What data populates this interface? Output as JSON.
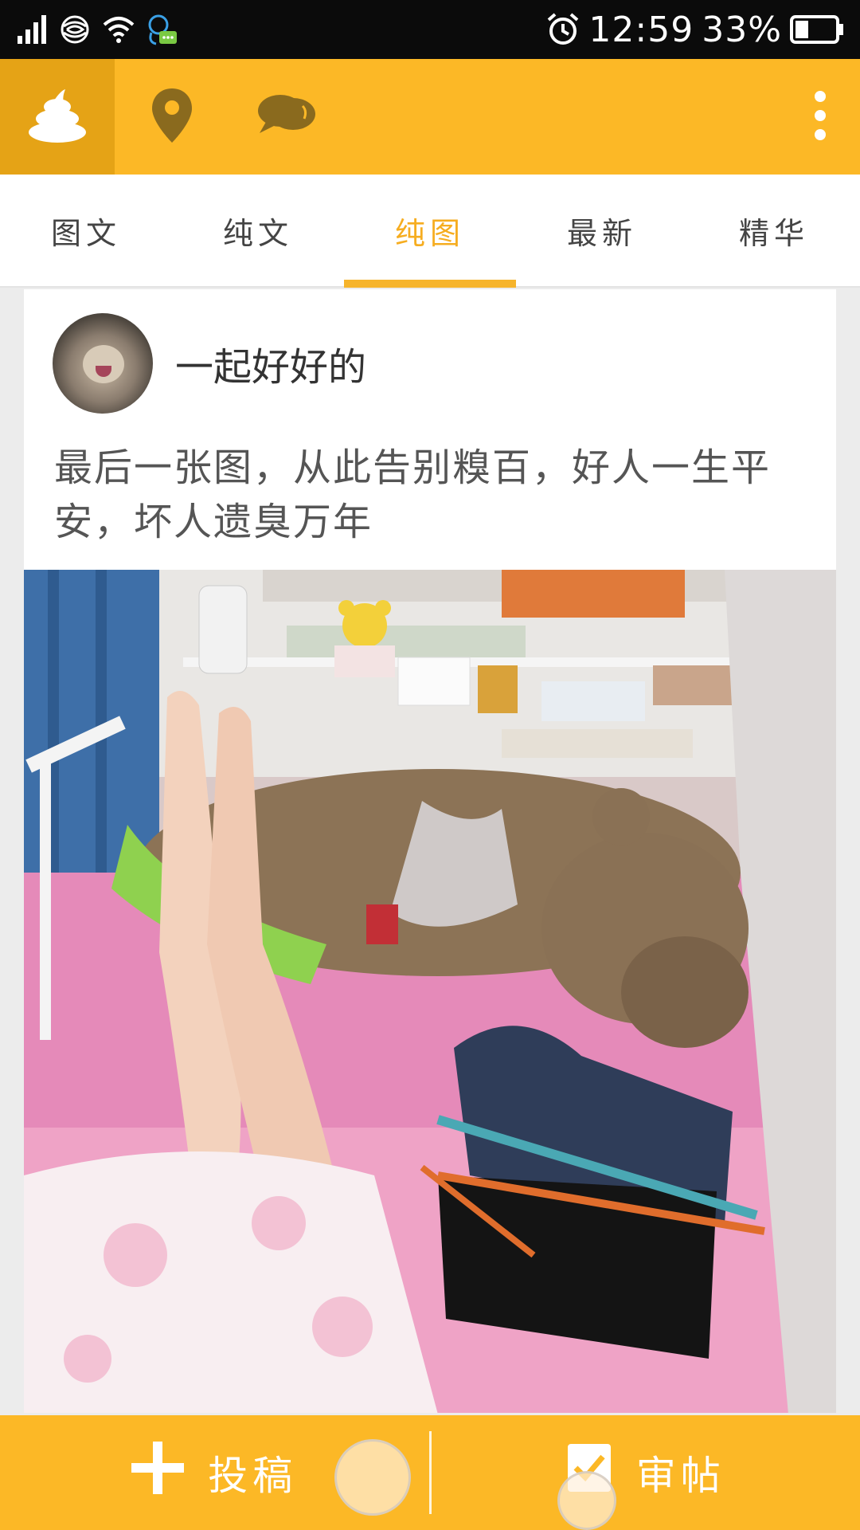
{
  "status_bar": {
    "time": "12:59",
    "battery_percent": "33%",
    "icons": [
      "signal-icon",
      "carrier-icon",
      "wifi-icon",
      "notification-bubble-icon",
      "alarm-icon",
      "battery-icon"
    ]
  },
  "top_bar": {
    "icons": [
      "poop-icon",
      "location-pin-icon",
      "chat-bubbles-icon",
      "more-vertical-icon"
    ],
    "accent_color": "#fcb826"
  },
  "tabs": {
    "items": [
      {
        "label": "图文",
        "active": false
      },
      {
        "label": "纯文",
        "active": false
      },
      {
        "label": "纯图",
        "active": true
      },
      {
        "label": "最新",
        "active": false
      },
      {
        "label": "精华",
        "active": false
      }
    ],
    "active_color": "#f6ad20"
  },
  "post": {
    "author": "一起好好的",
    "text": "最后一张图，从此告别糗百，好人一生平安，坏人遗臭万年"
  },
  "bottom_bar": {
    "submit_label": "投稿",
    "review_label": "审帖",
    "icons": [
      "plus-icon",
      "checkbox-icon"
    ]
  }
}
